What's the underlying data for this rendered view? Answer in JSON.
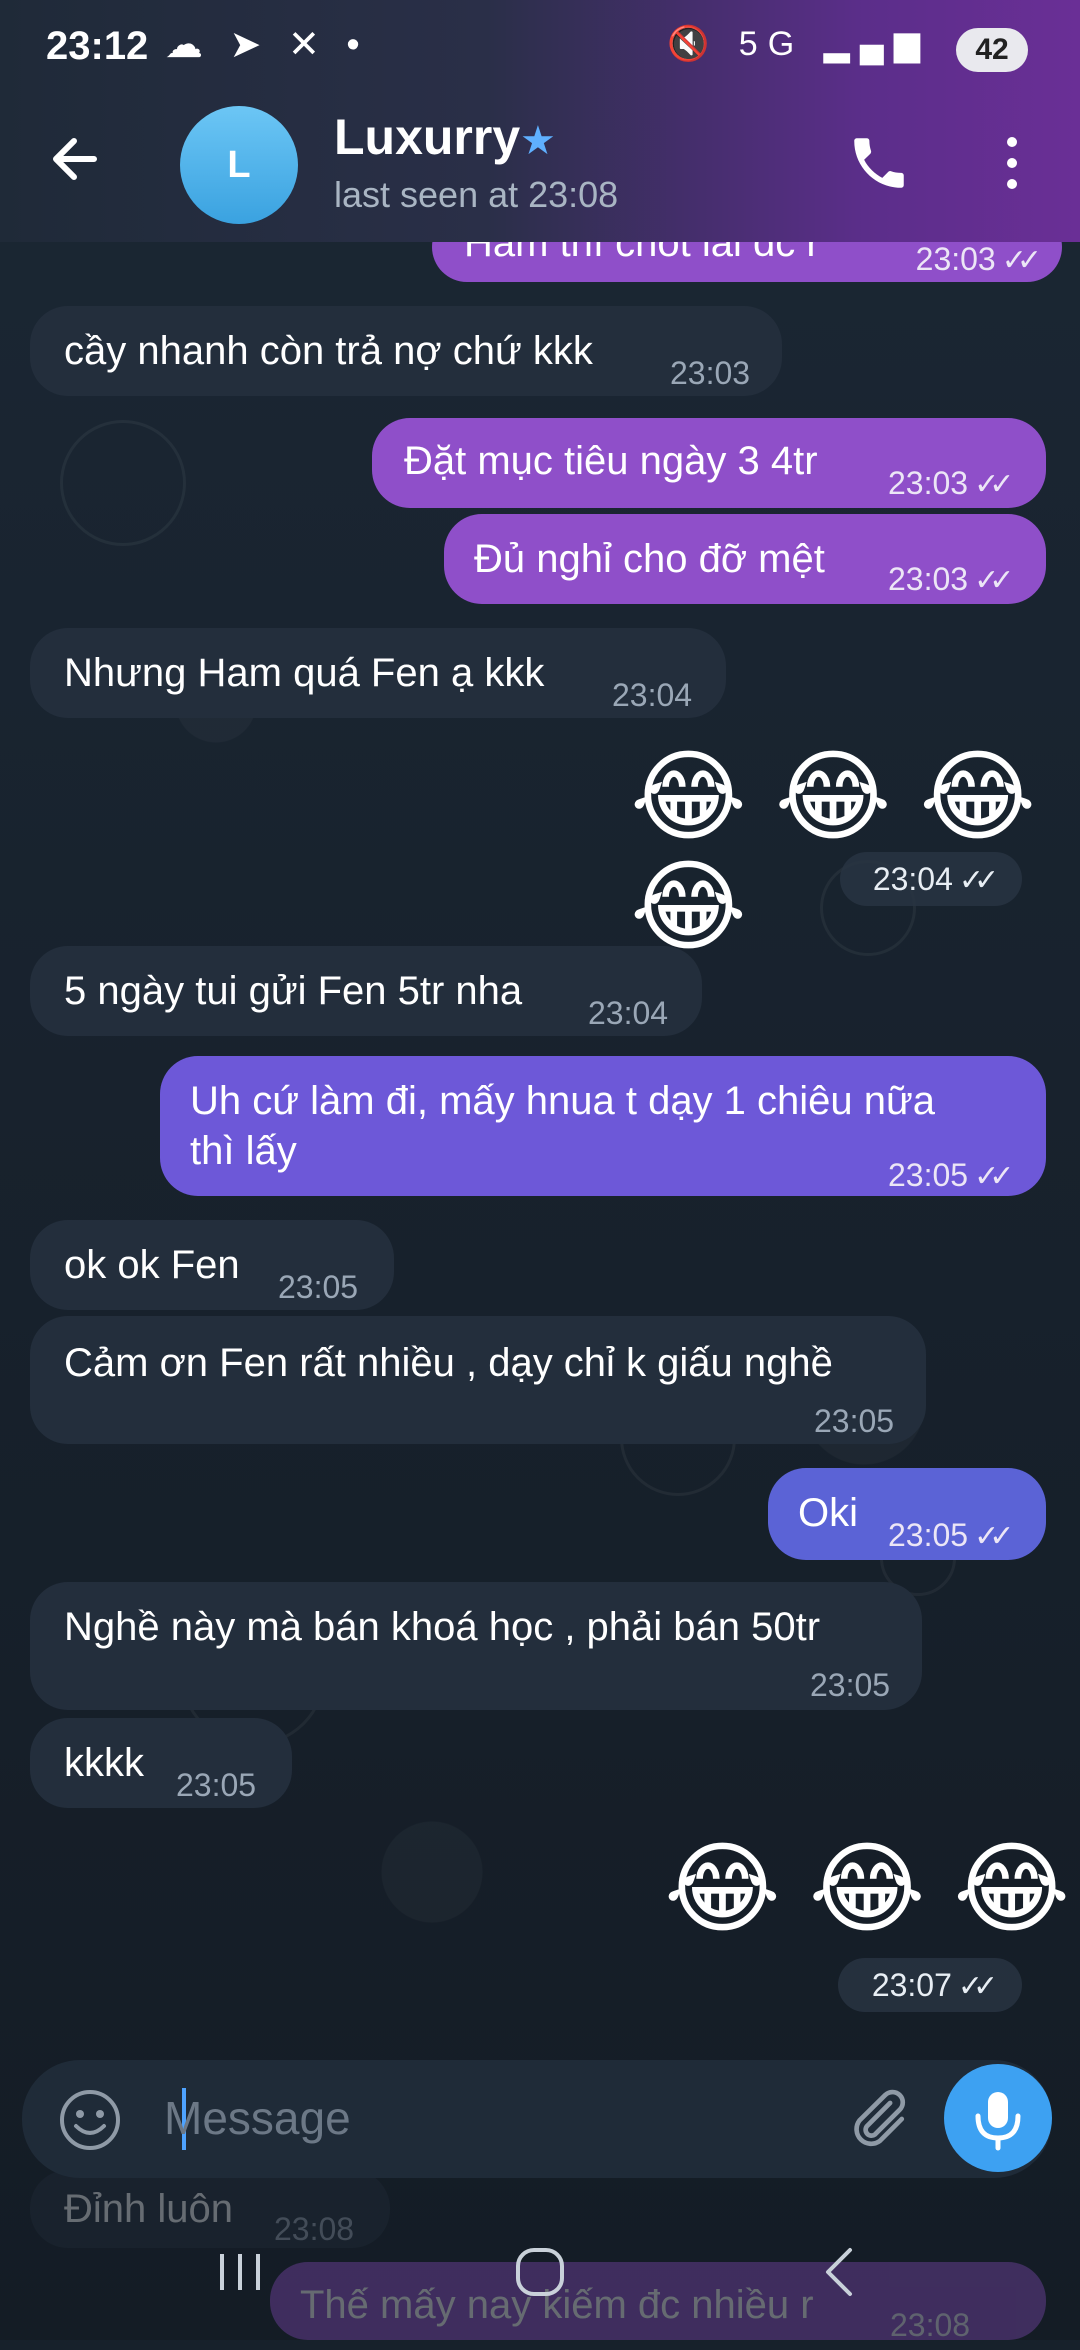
{
  "status_bar": {
    "time": "23:12",
    "left_icons": "☁ ➤ ✕ •",
    "right_icons": "🔇 5G ▂▄▆",
    "battery": "42"
  },
  "header": {
    "avatar_letter": "L",
    "title": "Luxurry",
    "subtitle": "last seen at 23:08"
  },
  "messages": [
    {
      "dir": "out",
      "text": "Ham thì chốt lãi dc r",
      "time": "23:03",
      "ticks": "✓✓"
    },
    {
      "dir": "in",
      "text": "cầy nhanh còn trả nợ chứ kkk",
      "time": "23:03"
    },
    {
      "dir": "out",
      "text": "Đặt mục tiêu ngày 3 4tr",
      "time": "23:03",
      "ticks": "✓✓"
    },
    {
      "dir": "out",
      "text": "Đủ nghỉ cho đỡ mệt",
      "time": "23:03",
      "ticks": "✓✓"
    },
    {
      "dir": "in",
      "text": "Nhưng Ham quá Fen ạ kkk",
      "time": "23:04"
    },
    {
      "dir": "out",
      "emoji": "😂 😂 😂 😂",
      "time": "23:04",
      "ticks": "✓✓"
    },
    {
      "dir": "in",
      "text": "5 ngày tui gửi Fen 5tr nha",
      "time": "23:04"
    },
    {
      "dir": "out",
      "text_line1": "Uh cứ làm đi, mấy hnua t dạy 1 chiêu nữa",
      "text_line2": "thì lấy",
      "time": "23:05",
      "ticks": "✓✓"
    },
    {
      "dir": "in",
      "text": "ok ok Fen",
      "time": "23:05"
    },
    {
      "dir": "in",
      "text": "Cảm ơn Fen rất nhiều , dạy chỉ k giấu nghề",
      "time": "23:05"
    },
    {
      "dir": "out",
      "text": "Oki",
      "time": "23:05",
      "ticks": "✓✓"
    },
    {
      "dir": "in",
      "text": "Nghề này mà bán khoá học , phải bán 50tr",
      "time": "23:05"
    },
    {
      "dir": "in",
      "text": "kkkk",
      "time": "23:05"
    },
    {
      "dir": "out",
      "emoji": "😂 😂 😂",
      "time": "23:07",
      "ticks": "✓✓"
    },
    {
      "dir": "in",
      "text": "Đỉnh luôn",
      "time": "23:08"
    },
    {
      "dir": "out",
      "text": "Thế mấy nay kiếm đc nhiều r",
      "time": "23:08"
    }
  ],
  "composer": {
    "placeholder": "Message"
  },
  "icons": {
    "back": "arrow-left-icon",
    "call": "phone-icon",
    "more": "more-vertical-icon",
    "emoji": "smile-icon",
    "attach": "paperclip-icon",
    "mic": "microphone-icon"
  },
  "colors": {
    "outgoing": "#8f4fc9",
    "outgoing_blue": "#5b63d6",
    "incoming": "#232e3c",
    "accent": "#3da1f2"
  }
}
